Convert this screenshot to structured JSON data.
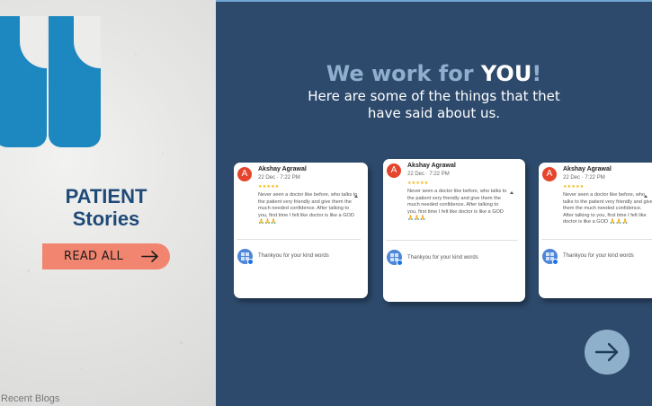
{
  "left_panel": {
    "title_line1": "PATIENT",
    "title_line2": "Stories",
    "read_all_label": "READ ALL",
    "footer_link": "Recent Blogs"
  },
  "header": {
    "headline_prefix": "We work for ",
    "headline_emphasis": "YOU",
    "headline_suffix": "!",
    "subheading": "Here are some of the things that thet have said about us."
  },
  "reviews": [
    {
      "initial": "A",
      "name": "Akshay Agrawal",
      "date": "22 Dec · 7:22 PM",
      "stars": "★★★★★",
      "text": "Never seen a doctor like before, who talks to the patient very friendly and give them the much needed confidence. After talking to you, first time I felt like doctor is like a GOD 🙏🙏🙏",
      "reply": "Thankyou for your kind words"
    },
    {
      "initial": "A",
      "name": "Akshay Agrawal",
      "date": "22 Dec · 7:22 PM",
      "stars": "★★★★★",
      "text": "Never seen a doctor like before, who talks to the patient very friendly and give them the much needed confidence. After talking to you, first time I felt like doctor is like a GOD 🙏🙏🙏",
      "reply": "Thankyou for your kind words"
    },
    {
      "initial": "A",
      "name": "Akshay Agrawal",
      "date": "22 Dec · 7:22 PM",
      "stars": "★★★★★",
      "text": "Never seen a doctor like before, who talks to the patient very friendly and give them the much needed confidence. After talking to you, first time I felt like doctor is like a GOD 🙏🙏🙏",
      "reply": "Thankyou for your kind words"
    }
  ],
  "colors": {
    "accent_blue": "#1d87bf",
    "title_navy": "#1f4a78",
    "button_salmon": "#f2856f",
    "panel_navy": "#2d4a6c",
    "next_button": "#8fb0cb"
  },
  "icons": {
    "quote": "quote-mark-icon",
    "read_all_arrow": "arrow-right-icon",
    "next": "arrow-right-circle-icon",
    "owner_avatar": "business-verified-icon"
  }
}
